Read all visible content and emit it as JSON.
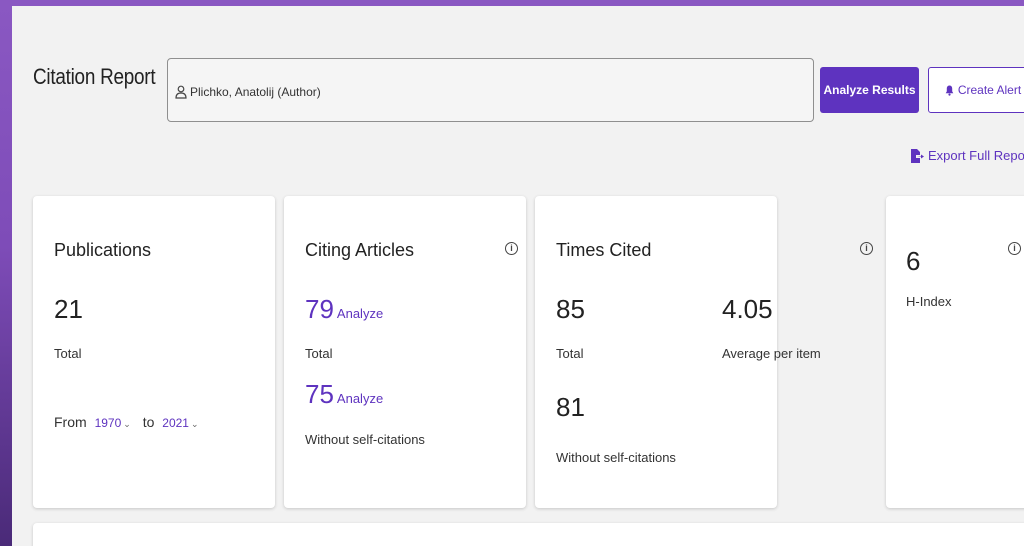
{
  "page_title": "Citation Report",
  "search": {
    "value": "Plichko, Anatolij (Author)",
    "icon": "person-icon"
  },
  "buttons": {
    "analyze_results": "Analyze Results",
    "create_alert": "Create Alert",
    "export": "Export Full Report"
  },
  "colors": {
    "accent": "#5e33bf",
    "background": "#f2f2f2",
    "card": "#ffffff"
  },
  "publications": {
    "title": "Publications",
    "total": "21",
    "total_label": "Total",
    "from_label": "From",
    "from_year": "1970",
    "to_label": "to",
    "to_year": "2021"
  },
  "citing_articles": {
    "title": "Citing Articles",
    "total": "79",
    "total_label": "Total",
    "without_self": "75",
    "without_self_label": "Without self-citations",
    "analyze_label": "Analyze"
  },
  "times_cited": {
    "title": "Times Cited",
    "total": "85",
    "total_label": "Total",
    "average": "4.05",
    "average_label": "Average per item",
    "without_self": "81",
    "without_self_label": "Without self-citations"
  },
  "h_index": {
    "value": "6",
    "label": "H-Index"
  }
}
